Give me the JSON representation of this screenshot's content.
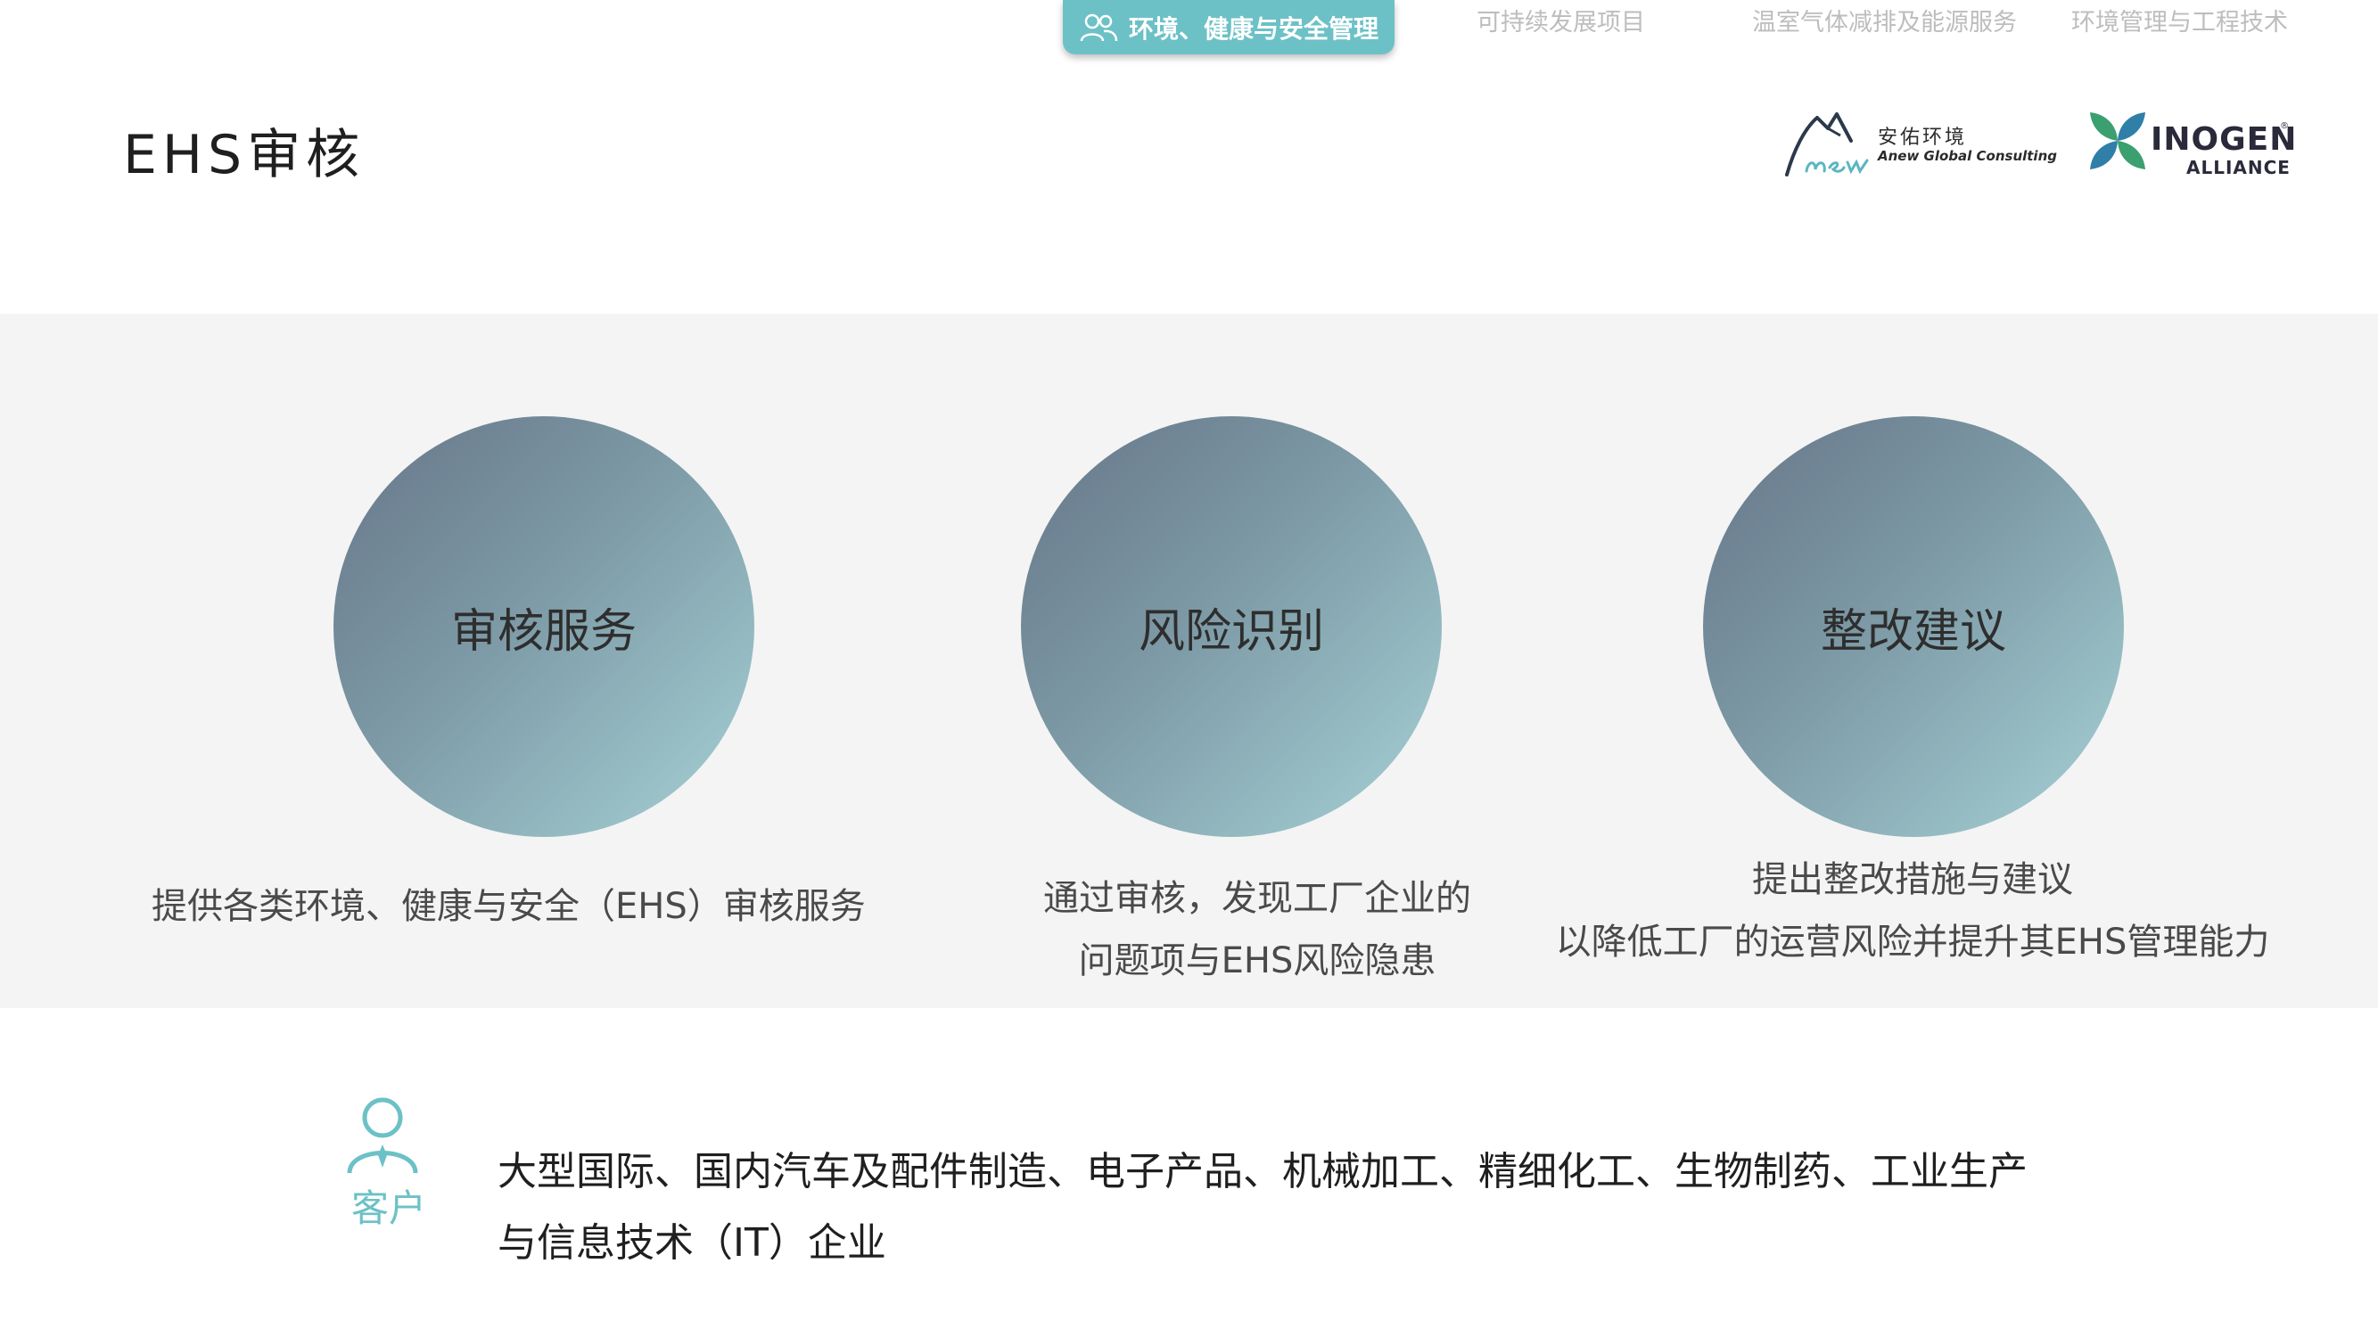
{
  "nav": {
    "active_tab": "环境、健康与安全管理",
    "tabs": [
      "可持续发展项目",
      "温室气体减排及能源服务",
      "环境管理与工程技术"
    ]
  },
  "page": {
    "title": "EHS审核"
  },
  "logos": {
    "anew": {
      "name_cn": "安佑环境",
      "name_en": "Anew Global Consulting"
    },
    "inogen": {
      "name": "INOGEN",
      "sub": "ALLIANCE",
      "reg": "®"
    }
  },
  "services": [
    {
      "title": "审核服务",
      "desc": [
        "提供各类环境、健康与安全（EHS）审核服务"
      ]
    },
    {
      "title": "风险识别",
      "desc": [
        "通过审核，发现工厂企业的",
        "问题项与EHS风险隐患"
      ]
    },
    {
      "title": "整改建议",
      "desc": [
        "提出整改措施与建议",
        "以降低工厂的运营风险并提升其EHS管理能力"
      ]
    }
  ],
  "client": {
    "label": "客户",
    "text": [
      "大型国际、国内汽车及配件制造、电子产品、机械加工、精细化工、生物制药、工业生产",
      "与信息技术（IT）企业"
    ]
  },
  "colors": {
    "accent": "#6cc1c6",
    "band": "#f4f4f4",
    "circle_start": "#667588",
    "circle_end": "#a6d2d6"
  }
}
